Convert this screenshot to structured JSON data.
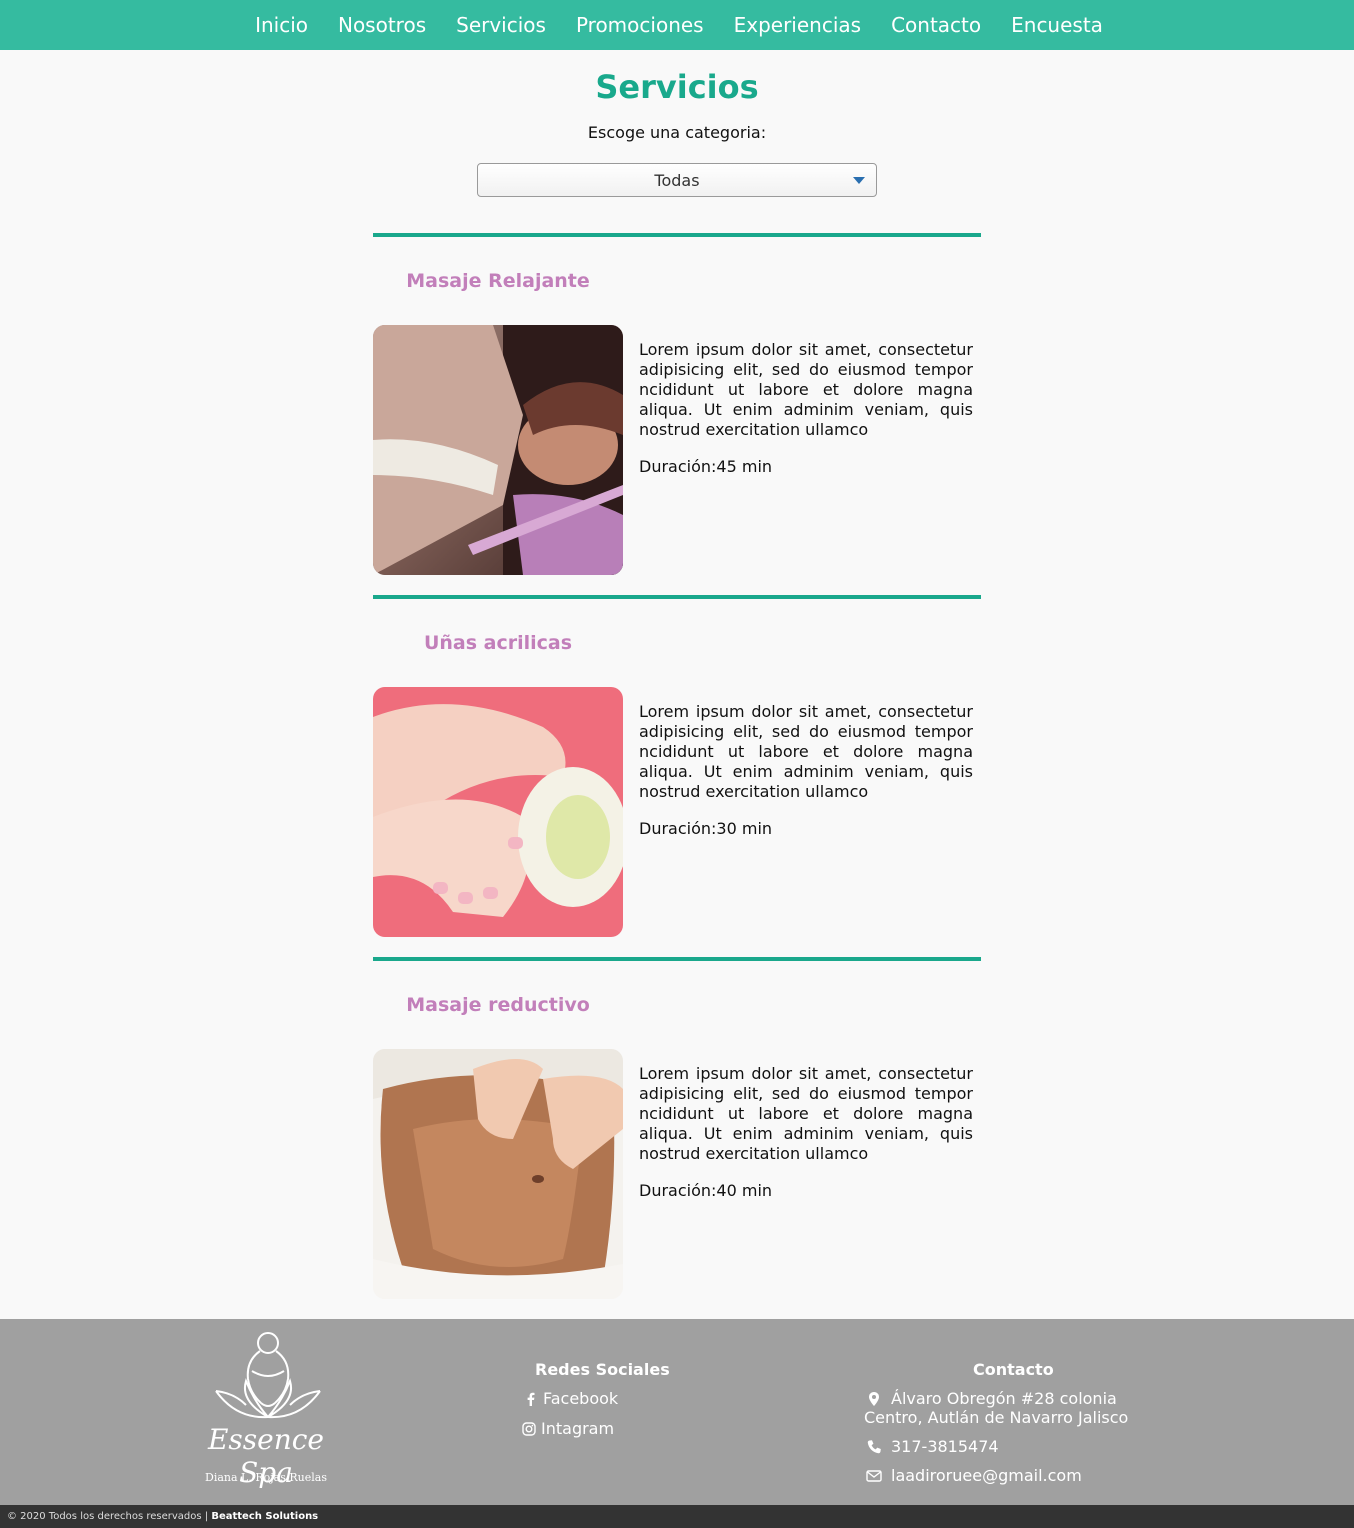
{
  "nav": {
    "items": [
      {
        "label": "Inicio"
      },
      {
        "label": "Nosotros"
      },
      {
        "label": "Servicios"
      },
      {
        "label": "Promociones"
      },
      {
        "label": "Experiencias"
      },
      {
        "label": "Contacto"
      },
      {
        "label": "Encuesta"
      }
    ]
  },
  "page": {
    "title": "Servicios",
    "category_label": "Escoge una categoria:",
    "category_selected": "Todas"
  },
  "services": [
    {
      "title": "Masaje Relajante",
      "description": "Lorem ipsum dolor sit amet, consectetur adipisicing elit, sed do eiusmod tempor ncididunt ut labore et dolore magna aliqua. Ut enim adminim veniam, quis nostrud exercitation ullamco",
      "duration": "Duración:45 min"
    },
    {
      "title": "Uñas acrilicas",
      "description": "Lorem ipsum dolor sit amet, consectetur adipisicing elit, sed do eiusmod tempor ncididunt ut labore et dolore magna aliqua. Ut enim adminim veniam, quis nostrud exercitation ullamco",
      "duration": "Duración:30 min"
    },
    {
      "title": "Masaje reductivo",
      "description": "Lorem ipsum dolor sit amet, consectetur adipisicing elit, sed do eiusmod tempor ncididunt ut labore et dolore magna aliqua. Ut enim adminim veniam, quis nostrud exercitation ullamco",
      "duration": "Duración:40 min"
    }
  ],
  "footer": {
    "brand": "Essence Spa",
    "brand_sub": "Diana L. Rojas Ruelas",
    "social_title": "Redes Sociales",
    "social": [
      {
        "label": "Facebook",
        "icon": "facebook-icon"
      },
      {
        "label": "Intagram",
        "icon": "instagram-icon"
      }
    ],
    "contact_title": "Contacto",
    "address": "Álvaro Obregón #28 colonia Centro, Autlán de Navarro Jalisco",
    "phone": "317-3815474",
    "email": "laadiroruee@gmail.com",
    "copyright": "© 2020 Todos los derechos reservados |",
    "company": "Beattech Solutions"
  },
  "colors": {
    "nav_bg": "#35bba0",
    "accent": "#1aa88c",
    "service_title": "#c27fba",
    "footer_bg": "#a0a0a0",
    "bottom_bar": "#333333"
  }
}
